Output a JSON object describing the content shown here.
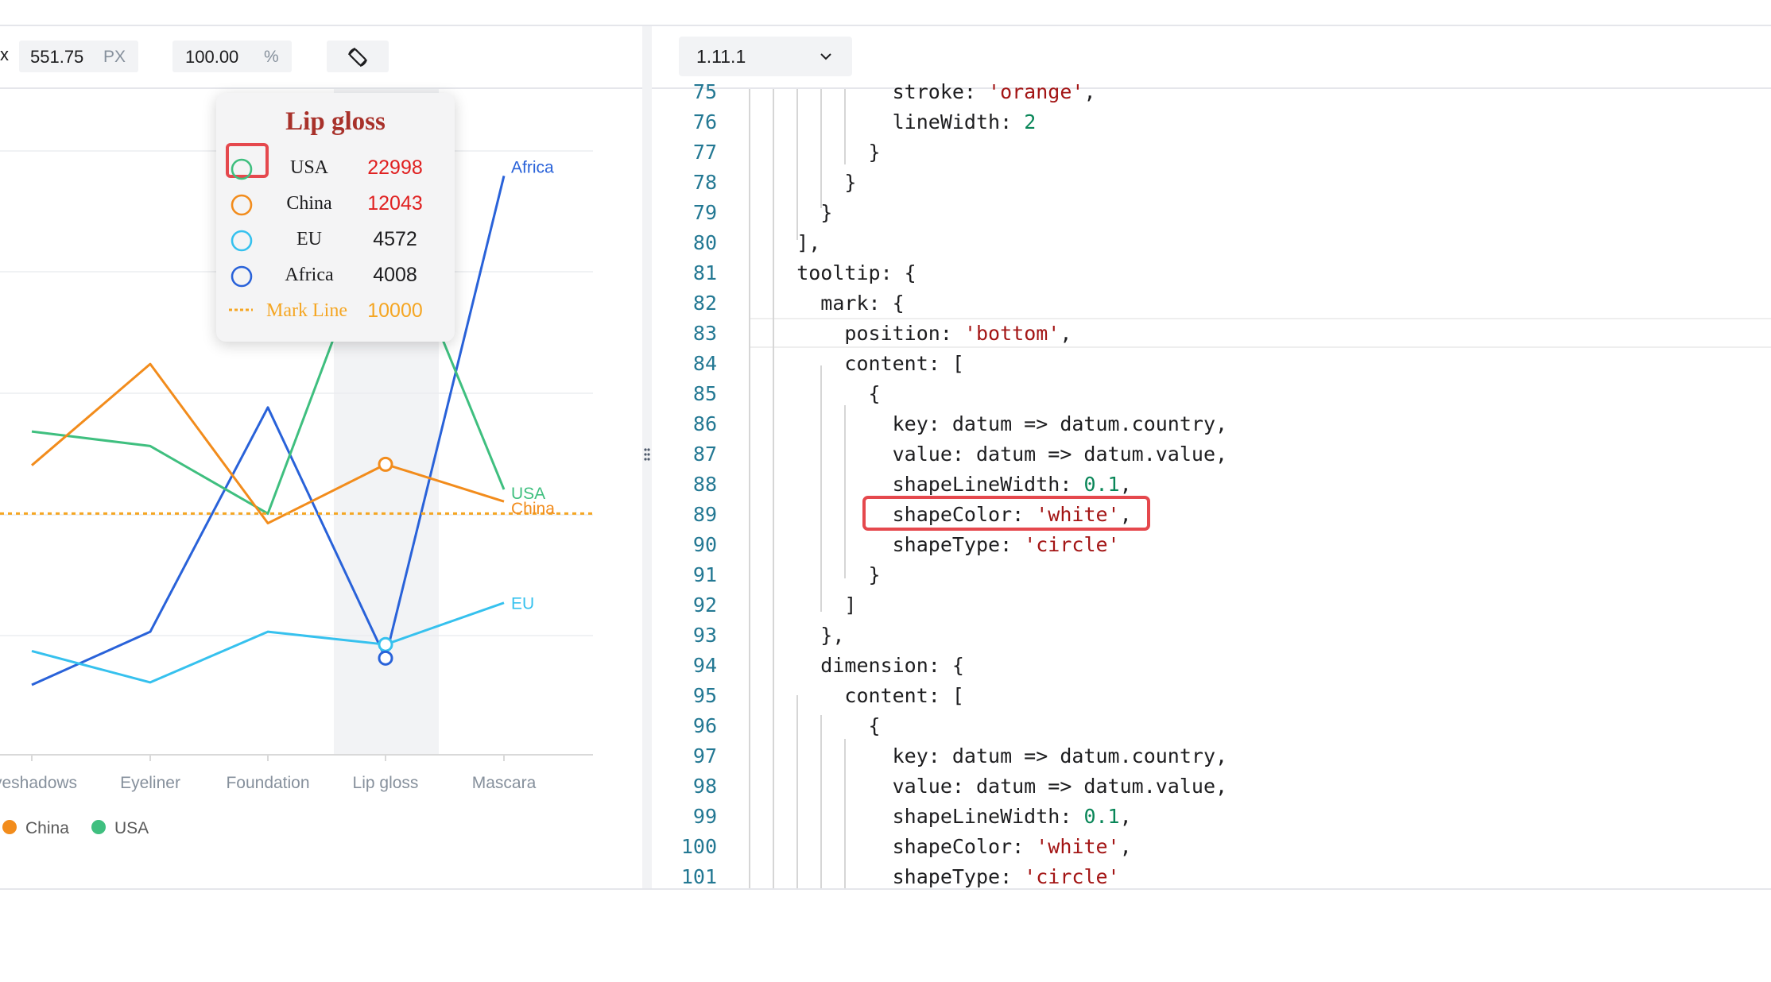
{
  "toolbar": {
    "width_prefix": "x",
    "width_value": "551.75",
    "width_unit": "PX",
    "scale_value": "100.00",
    "scale_unit": "%",
    "rotate_icon": "rotate-device-icon"
  },
  "version_select": {
    "value": "1.11.1",
    "icon": "chevron-down-icon"
  },
  "splitter": {
    "icon": "drag-handle-icon"
  },
  "chart_data": {
    "type": "line",
    "categories": [
      "Eyeshadows",
      "Eyeliner",
      "Foundation",
      "Lip gloss",
      "Mascara"
    ],
    "x_labels_visible": [
      "yeshadows",
      "Eyeliner",
      "Foundation",
      "Lip gloss",
      "Mascara"
    ],
    "series": [
      {
        "name": "Africa",
        "color": "#2962d9",
        "values": [
          2900,
          5100,
          14400,
          4008,
          24000
        ]
      },
      {
        "name": "USA",
        "color": "#3fbf7f",
        "values": [
          13400,
          12800,
          10000,
          22998,
          11000
        ]
      },
      {
        "name": "China",
        "color": "#f28c1c",
        "values": [
          12000,
          16200,
          9600,
          12043,
          10500
        ]
      },
      {
        "name": "EU",
        "color": "#36c1ee",
        "values": [
          4300,
          3000,
          5100,
          4572,
          6300
        ]
      }
    ],
    "mark_line": {
      "label": "Mark Line",
      "value": 10000,
      "color": "#f5a623"
    },
    "highlight_category": "Lip gloss",
    "end_labels": [
      "Africa",
      "USA",
      "China",
      "EU"
    ],
    "legend_visible": [
      {
        "name": "China",
        "color": "#f28c1c"
      },
      {
        "name": "USA",
        "color": "#3fbf7f"
      }
    ],
    "grid": true
  },
  "tooltip": {
    "title": "Lip gloss",
    "rows": [
      {
        "key": "USA",
        "value": "22998",
        "color": "#3fbf7f",
        "value_color": "#e02020"
      },
      {
        "key": "China",
        "value": "12043",
        "color": "#f28c1c",
        "value_color": "#e02020"
      },
      {
        "key": "EU",
        "value": "4572",
        "color": "#36c1ee",
        "value_color": "#1d1d1f"
      },
      {
        "key": "Africa",
        "value": "4008",
        "color": "#2962d9",
        "value_color": "#1d1d1f"
      }
    ],
    "mark_line": {
      "key": "Mark Line",
      "value": "10000",
      "color": "#f5a623"
    }
  },
  "code": {
    "lines": [
      {
        "n": "75",
        "t": "            stroke: 'orange',",
        "cut": "top"
      },
      {
        "n": "76",
        "t": "            lineWidth: 2"
      },
      {
        "n": "77",
        "t": "          }"
      },
      {
        "n": "78",
        "t": "        }"
      },
      {
        "n": "79",
        "t": "      }"
      },
      {
        "n": "80",
        "t": "    ],"
      },
      {
        "n": "81",
        "t": "    tooltip: {"
      },
      {
        "n": "82",
        "t": "      mark: {"
      },
      {
        "n": "83",
        "t": "        position: 'bottom',",
        "current": true
      },
      {
        "n": "84",
        "t": "        content: ["
      },
      {
        "n": "85",
        "t": "          {"
      },
      {
        "n": "86",
        "t": "            key: datum => datum.country,"
      },
      {
        "n": "87",
        "t": "            value: datum => datum.value,"
      },
      {
        "n": "88",
        "t": "            shapeLineWidth: 0.1,"
      },
      {
        "n": "89",
        "t": "            shapeColor: 'white',",
        "highlight": true
      },
      {
        "n": "90",
        "t": "            shapeType: 'circle'"
      },
      {
        "n": "91",
        "t": "          }"
      },
      {
        "n": "92",
        "t": "        ]"
      },
      {
        "n": "93",
        "t": "      },"
      },
      {
        "n": "94",
        "t": "      dimension: {"
      },
      {
        "n": "95",
        "t": "        content: ["
      },
      {
        "n": "96",
        "t": "          {"
      },
      {
        "n": "97",
        "t": "            key: datum => datum.country,"
      },
      {
        "n": "98",
        "t": "            value: datum => datum.value,"
      },
      {
        "n": "99",
        "t": "            shapeLineWidth: 0.1,"
      },
      {
        "n": "100",
        "t": "            shapeColor: 'white',"
      },
      {
        "n": "101",
        "t": "            shapeType: 'circle'",
        "cut": "bottom"
      }
    ]
  },
  "colors": {
    "highlight_box": "#e5484d",
    "accent": "#3b6ef5"
  }
}
